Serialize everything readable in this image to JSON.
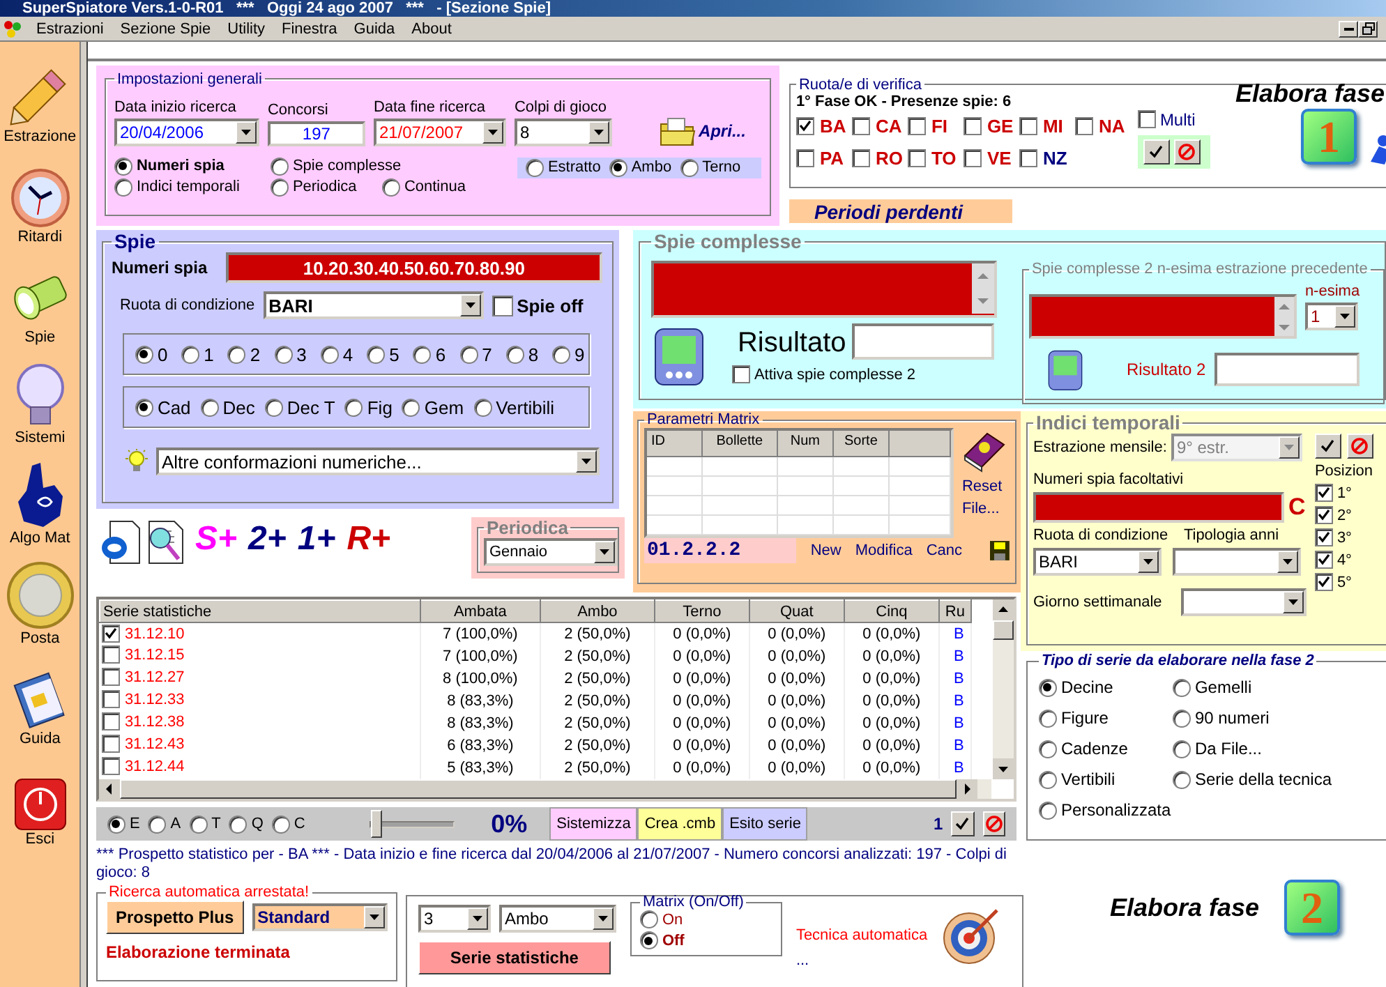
{
  "window": {
    "title": "SuperSpiatore Vers.1-0-R01   ***   Oggi 24 ago 2007   ***   - [Sezione Spie]"
  },
  "menu": [
    "Estrazioni",
    "Sezione Spie",
    "Utility",
    "Finestra",
    "Guida",
    "About"
  ],
  "sidebar": [
    {
      "label": "Estrazione",
      "kind": "pencil"
    },
    {
      "label": "Ritardi",
      "kind": "clock"
    },
    {
      "label": "Spie",
      "kind": "flashlight"
    },
    {
      "label": "Sistemi",
      "kind": "bulb"
    },
    {
      "label": "Algo Mat",
      "kind": "hand"
    },
    {
      "label": "Posta",
      "kind": "coin"
    },
    {
      "label": "Guida",
      "kind": "book"
    },
    {
      "label": "Esci",
      "kind": "power"
    }
  ],
  "general": {
    "title": "Impostazioni generali",
    "fields": [
      {
        "label": "Data inizio ricerca",
        "value": "20/04/2006",
        "kind": "combo",
        "color": "#0000ff"
      },
      {
        "label": "Concorsi",
        "value": "197",
        "kind": "input",
        "color": "#0000ff"
      },
      {
        "label": "Data fine ricerca",
        "value": "21/07/2007",
        "kind": "combo",
        "color": "#ff0000"
      },
      {
        "label": "Colpi di gioco",
        "value": "8",
        "kind": "combo",
        "color": "#000000"
      }
    ],
    "modes": [
      {
        "label": "Numeri spia",
        "selected": true
      },
      {
        "label": "Spie complesse",
        "selected": false
      },
      {
        "label": "Indici temporali",
        "selected": false
      },
      {
        "label": "Periodica",
        "selected": false
      },
      {
        "label": "Continua",
        "selected": false
      }
    ],
    "play": [
      {
        "label": "Estratto",
        "selected": false
      },
      {
        "label": "Ambo",
        "selected": true
      },
      {
        "label": "Terno",
        "selected": false
      }
    ],
    "open_button": "Apri..."
  },
  "verify": {
    "title": "Ruota/e di verifica",
    "status": "1° Fase OK - Presenze spie: 6",
    "wheels": [
      {
        "label": "BA",
        "checked": true,
        "color": "#cc0000"
      },
      {
        "label": "CA",
        "checked": false,
        "color": "#cc0000"
      },
      {
        "label": "FI",
        "checked": false,
        "color": "#cc0000"
      },
      {
        "label": "GE",
        "checked": false,
        "color": "#cc0000"
      },
      {
        "label": "MI",
        "checked": false,
        "color": "#cc0000"
      },
      {
        "label": "NA",
        "checked": false,
        "color": "#cc0000"
      },
      {
        "label": "PA",
        "checked": false,
        "color": "#cc0000"
      },
      {
        "label": "RO",
        "checked": false,
        "color": "#cc0000"
      },
      {
        "label": "TO",
        "checked": false,
        "color": "#cc0000"
      },
      {
        "label": "VE",
        "checked": false,
        "color": "#cc0000"
      },
      {
        "label": "NZ",
        "checked": false,
        "color": "#000080"
      }
    ],
    "multi": {
      "label": "Multi",
      "checked": false
    }
  },
  "elabora_1": {
    "label": "Elabora fase",
    "digit": "1"
  },
  "periodi_perdenti": "Periodi perdenti",
  "spie": {
    "title": "Spie",
    "numbers_label": "Numeri spia",
    "numbers": "10.20.30.40.50.60.70.80.90",
    "wheel_label": "Ruota di condizione",
    "wheel": "BARI",
    "off": {
      "label": "Spie off",
      "checked": false
    },
    "digits": [
      {
        "label": "0",
        "selected": true
      },
      {
        "label": "1",
        "selected": false
      },
      {
        "label": "2",
        "selected": false
      },
      {
        "label": "3",
        "selected": false
      },
      {
        "label": "4",
        "selected": false
      },
      {
        "label": "5",
        "selected": false
      },
      {
        "label": "6",
        "selected": false
      },
      {
        "label": "7",
        "selected": false
      },
      {
        "label": "8",
        "selected": false
      },
      {
        "label": "9",
        "selected": false
      }
    ],
    "groups": [
      {
        "label": "Cad",
        "selected": true
      },
      {
        "label": "Dec",
        "selected": false
      },
      {
        "label": "Dec T",
        "selected": false
      },
      {
        "label": "Fig",
        "selected": false
      },
      {
        "label": "Gem",
        "selected": false
      },
      {
        "label": "Vertibili",
        "selected": false
      }
    ],
    "other": "Altre conformazioni numeriche..."
  },
  "quick": [
    {
      "label": "S+",
      "color": "#ff00ff"
    },
    {
      "label": "2+",
      "color": "#000080"
    },
    {
      "label": "1+",
      "color": "#000080"
    },
    {
      "label": "R+",
      "color": "#cc0000"
    }
  ],
  "periodica": {
    "title": "Periodica",
    "value": "Gennaio"
  },
  "complesse": {
    "title": "Spie complesse",
    "result_label": "Risultato",
    "activate": {
      "label": "Attiva spie complesse 2",
      "checked": false
    },
    "sub": {
      "title": "Spie complesse 2 n-esima estrazione precedente",
      "n_label": "n-esima",
      "n": "1",
      "result_label": "Risultato 2"
    }
  },
  "matrix": {
    "title": "Parametri Matrix",
    "columns": [
      "ID",
      "Bollette",
      "Num",
      "Sorte"
    ],
    "code": "01.2.2.2",
    "links": [
      "Reset",
      "File..."
    ],
    "actions": [
      "New",
      "Modifica",
      "Canc"
    ]
  },
  "indici": {
    "title": "Indici temporali",
    "monthly_label": "Estrazione mensile:",
    "monthly": "9° estr.",
    "optional_label": "Numeri spia facoltativi",
    "clear": "C",
    "wheel_label": "Ruota di condizione",
    "wheel": "BARI",
    "years_label": "Tipologia anni",
    "weekday_label": "Giorno settimanale",
    "positions_label": "Posizion",
    "positions": [
      {
        "label": "1°",
        "checked": true
      },
      {
        "label": "2°",
        "checked": true
      },
      {
        "label": "3°",
        "checked": true
      },
      {
        "label": "4°",
        "checked": true
      },
      {
        "label": "5°",
        "checked": true
      }
    ]
  },
  "table": {
    "columns": [
      "Serie statistiche",
      "Ambata",
      "Ambo",
      "Terno",
      "Quat",
      "Cinq",
      "Ru"
    ],
    "rows": [
      {
        "checked": true,
        "cells": [
          "31.12.10",
          "7 (100,0%)",
          "2 (50,0%)",
          "0 (0,0%)",
          "0 (0,0%)",
          "0 (0,0%)",
          "B"
        ]
      },
      {
        "checked": false,
        "cells": [
          "31.12.15",
          "7 (100,0%)",
          "2 (50,0%)",
          "0 (0,0%)",
          "0 (0,0%)",
          "0 (0,0%)",
          "B"
        ]
      },
      {
        "checked": false,
        "cells": [
          "31.12.27",
          "8 (100,0%)",
          "2 (50,0%)",
          "0 (0,0%)",
          "0 (0,0%)",
          "0 (0,0%)",
          "B"
        ]
      },
      {
        "checked": false,
        "cells": [
          "31.12.33",
          "8 (83,3%)",
          "2 (50,0%)",
          "0 (0,0%)",
          "0 (0,0%)",
          "0 (0,0%)",
          "B"
        ]
      },
      {
        "checked": false,
        "cells": [
          "31.12.38",
          "8 (83,3%)",
          "2 (50,0%)",
          "0 (0,0%)",
          "0 (0,0%)",
          "0 (0,0%)",
          "B"
        ]
      },
      {
        "checked": false,
        "cells": [
          "31.12.43",
          "6 (83,3%)",
          "2 (50,0%)",
          "0 (0,0%)",
          "0 (0,0%)",
          "0 (0,0%)",
          "B"
        ]
      },
      {
        "checked": false,
        "cells": [
          "31.12.44",
          "5 (83,3%)",
          "2 (50,0%)",
          "0 (0,0%)",
          "0 (0,0%)",
          "0 (0,0%)",
          "B"
        ]
      }
    ]
  },
  "bar": {
    "sorts": [
      {
        "label": "E",
        "selected": true
      },
      {
        "label": "A",
        "selected": false
      },
      {
        "label": "T",
        "selected": false
      },
      {
        "label": "Q",
        "selected": false
      },
      {
        "label": "C",
        "selected": false
      }
    ],
    "level": 0,
    "percent": "0%",
    "buttons": [
      {
        "label": "Sistemizza",
        "color": "#ffccff"
      },
      {
        "label": "Crea .cmb",
        "color": "#ffff99"
      },
      {
        "label": "Esito serie",
        "color": "#ccccff"
      }
    ],
    "count": "1"
  },
  "summary": "*** Prospetto statistico per  - BA ***  - Data inizio e fine ricerca dal 20/04/2006 al 21/07/2007 - Numero concorsi analizzati: 197 - Colpi di gioco: 8",
  "auto": {
    "title": "Ricerca automatica arrestata!",
    "button": "Prospetto Plus",
    "mode": "Standard",
    "status": "Elaborazione terminata"
  },
  "series": {
    "count": "3",
    "sorte": "Ambo",
    "button": "Serie statistiche",
    "matrix_title": "Matrix (On/Off)",
    "matrix": [
      {
        "label": "On",
        "selected": false
      },
      {
        "label": "Off",
        "selected": true
      }
    ],
    "tecnica": "Tecnica automatica",
    "dots": "..."
  },
  "tipo": {
    "title": "Tipo di serie da elaborare nella fase 2",
    "options": [
      {
        "label": "Decine",
        "selected": true
      },
      {
        "label": "Gemelli",
        "selected": false
      },
      {
        "label": "Figure",
        "selected": false
      },
      {
        "label": "90 numeri",
        "selected": false
      },
      {
        "label": "Cadenze",
        "selected": false
      },
      {
        "label": "Da File...",
        "selected": false
      },
      {
        "label": "Vertibili",
        "selected": false
      },
      {
        "label": "Serie della tecnica",
        "selected": false
      },
      {
        "label": "Personalizzata",
        "selected": false
      }
    ]
  },
  "elabora_2": {
    "label": "Elabora fase",
    "digit": "2"
  }
}
